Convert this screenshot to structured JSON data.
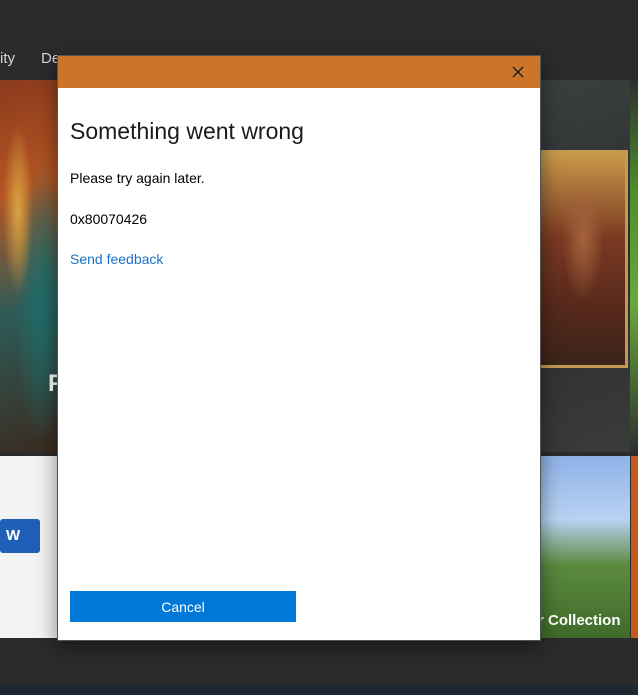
{
  "background": {
    "nav": {
      "item1": "ity",
      "item2": "De"
    },
    "featured_tile_text": "F",
    "collection_tile_text": "r Collection",
    "word_icon_letter": "W"
  },
  "dialog": {
    "title": "Something went wrong",
    "message": "Please try again later.",
    "error_code": "0x80070426",
    "feedback_link": "Send feedback",
    "cancel_label": "Cancel",
    "titlebar_color": "#cd742b",
    "accent_color": "#0078d7",
    "link_color": "#1a72c8",
    "close_icon": "close-icon"
  }
}
